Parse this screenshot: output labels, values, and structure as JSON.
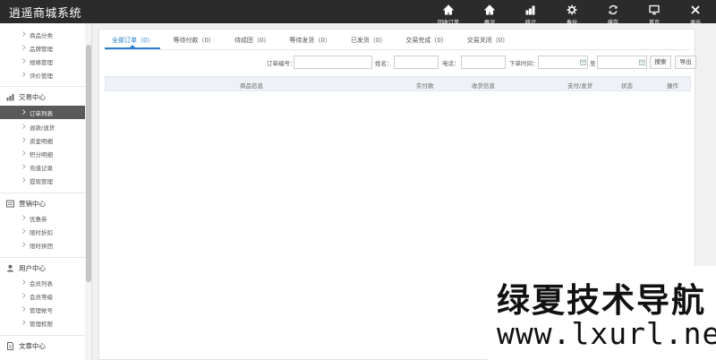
{
  "app": {
    "title": "逍遥商城系统"
  },
  "topnav": [
    {
      "label": "回收订单",
      "icon": "home-icon"
    },
    {
      "label": "概况",
      "icon": "home-icon"
    },
    {
      "label": "统计",
      "icon": "bar-chart-icon"
    },
    {
      "label": "备份",
      "icon": "gear-icon"
    },
    {
      "label": "缓存",
      "icon": "refresh-icon"
    },
    {
      "label": "首页",
      "icon": "monitor-icon"
    },
    {
      "label": "退出",
      "icon": "close-icon"
    }
  ],
  "sidebar": {
    "items_top": [
      "商品分类",
      "品牌管理",
      "规格管理",
      "评价管理"
    ],
    "group_trade": {
      "label": "交易中心",
      "icon": "bar-chart-icon"
    },
    "items_trade": [
      "订单列表",
      "退款/退货",
      "资金明细",
      "积分明细",
      "充值记录",
      "提现管理"
    ],
    "active_item": "订单列表",
    "group_marketing": {
      "label": "营销中心",
      "icon": "list-icon"
    },
    "items_marketing": [
      "优惠券",
      "限时折扣",
      "限时拼团"
    ],
    "group_user": {
      "label": "用户中心",
      "icon": "user-icon"
    },
    "items_user": [
      "会员列表",
      "会员等级",
      "管理帐号",
      "管理权限"
    ],
    "group_article": {
      "label": "文章中心",
      "icon": "document-icon"
    }
  },
  "tabs": [
    "全部订单（0）",
    "等待付款（0）",
    "待成团（0）",
    "等待发货（0）",
    "已发货（0）",
    "交易完成（0）",
    "交易关闭（0）"
  ],
  "filters": {
    "order_no_label": "订单编号：",
    "order_no_value": "",
    "name_label": "姓名：",
    "name_value": "",
    "phone_label": "电话：",
    "phone_value": "",
    "time_label": "下单时间：",
    "time_from": "",
    "time_to": "",
    "time_sep": "至",
    "search_button": "搜索",
    "export_button": "导出"
  },
  "table": {
    "columns": [
      "商品信息",
      "实付款",
      "收货信息",
      "支付/发货",
      "状态",
      "操作"
    ],
    "rows": []
  },
  "watermark": {
    "cn": "绿夏技术导航",
    "url": "www.lxurl.net"
  }
}
